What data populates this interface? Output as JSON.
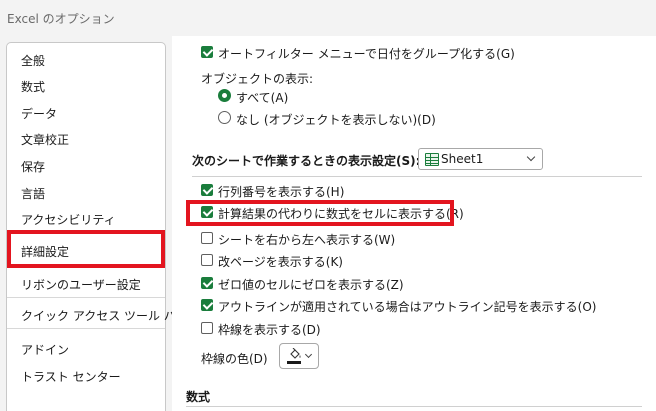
{
  "window": {
    "title": "Excel のオプション"
  },
  "sidebar": {
    "items": [
      {
        "label": "全般"
      },
      {
        "label": "数式"
      },
      {
        "label": "データ"
      },
      {
        "label": "文章校正"
      },
      {
        "label": "保存"
      },
      {
        "label": "言語"
      },
      {
        "label": "アクセシビリティ"
      },
      {
        "label": "詳細設定",
        "selected": true
      },
      {
        "label": "リボンのユーザー設定"
      },
      {
        "label": "クイック アクセス ツール バー"
      },
      {
        "label": "アドイン"
      },
      {
        "label": "トラスト センター"
      }
    ]
  },
  "main": {
    "autofilter": {
      "label": "オートフィルター メニューで日付をグループ化する(G)",
      "checked": true
    },
    "objects": {
      "label": "オブジェクトの表示:",
      "all": {
        "label": "すべて(A)",
        "selected": true
      },
      "none": {
        "label": "なし (オブジェクトを表示しない)(D)",
        "selected": false
      }
    },
    "sheet_section": {
      "label": "次のシートで作業するときの表示設定(S):",
      "sheet": "Sheet1",
      "options": [
        {
          "label": "行列番号を表示する(H)",
          "checked": true
        },
        {
          "label": "計算結果の代わりに数式をセルに表示する(R)",
          "checked": true
        },
        {
          "label": "シートを右から左へ表示する(W)",
          "checked": false
        },
        {
          "label": "改ページを表示する(K)",
          "checked": false
        },
        {
          "label": "ゼロ値のセルにゼロを表示する(Z)",
          "checked": true
        },
        {
          "label": "アウトラインが適用されている場合はアウトライン記号を表示する(O)",
          "checked": true
        },
        {
          "label": "枠線を表示する(D)",
          "checked": false
        }
      ],
      "gridline_color_label": "枠線の色(D)"
    },
    "formulas_section": {
      "label": "数式"
    }
  },
  "colors": {
    "accent": "#1a7d3c",
    "highlight": "#e3151f"
  }
}
